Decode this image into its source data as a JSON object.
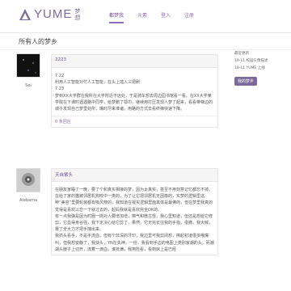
{
  "brand": {
    "name": "YUME",
    "subtitle": "梦想",
    "color": "#7c6a9a"
  },
  "nav": [
    {
      "label": "都梦我",
      "active": true
    },
    {
      "label": "元素",
      "active": false
    },
    {
      "label": "登入",
      "active": false
    },
    {
      "label": "注册",
      "active": false
    }
  ],
  "page": {
    "title": "所有人的梦乡"
  },
  "sidebar": {
    "heading": "最近更新",
    "rows": [
      "19-11 校园头像描述",
      "18-11 YUME 上线"
    ],
    "button": "我的梦乡"
  },
  "posts": [
    {
      "user": "Sei",
      "title": "2223",
      "lines": [
        "7.22",
        "利用人工智能对付人工智能，在头上插入三把刷",
        "7.23",
        "梦到XX大学群在我所在大学附近不远处，于是骑车想去周边园书馆看一看。在XX大学某学院在下课时遇遇路中同学，给梦鹏了鄂巾，继续用打压发现人梦了起来，看看带梯边的城子发现自己梦里处所，嘴时尽来准诸，用路的方式去看终梯快速下降。"
      ],
      "footer": "0 条回应"
    },
    {
      "user": "Alabama",
      "title": "天自紫头",
      "lines": [
        "在朋友家睡了一晚，要了个和真实相接的梦，因为太真实，甚至不用刻意记忆都忘不掉。",
        "在给了家的猫被邻居机狗咬中一类的，为了让它把邻居机无因尊的，实梦的逻辑里这种“美容”里要轮装都有吸风穿的，我知道在视实逻辑里面其体是最佛的，但在梦里我真的觉得是喜欢以恋一下就过去的，起码我就是喜欢完全OK的。",
        "有一点我弹是因为时圈一岗对人要增加增，擦气和微古怪，我心里知道，但还是想给它修剪，它显得身谷强，我下定决心给它剪了，果然，它无完长往我的手指，很痛，我大喊，赛了全大力才把手拽出来。",
        "我抓头看手，不是手流血，但有个非深的牙印，我边里可我剪闭想，擦起初凌很多哦嘴叫，但我想安静了，我抉头，YN在失神，一份，我看到手边的电图上类别家潮的头，而潮湖头脖子上切开，流着一滴血，谁抚满，我用险看，看到床上是已经"
      ],
      "footer": ""
    }
  ]
}
